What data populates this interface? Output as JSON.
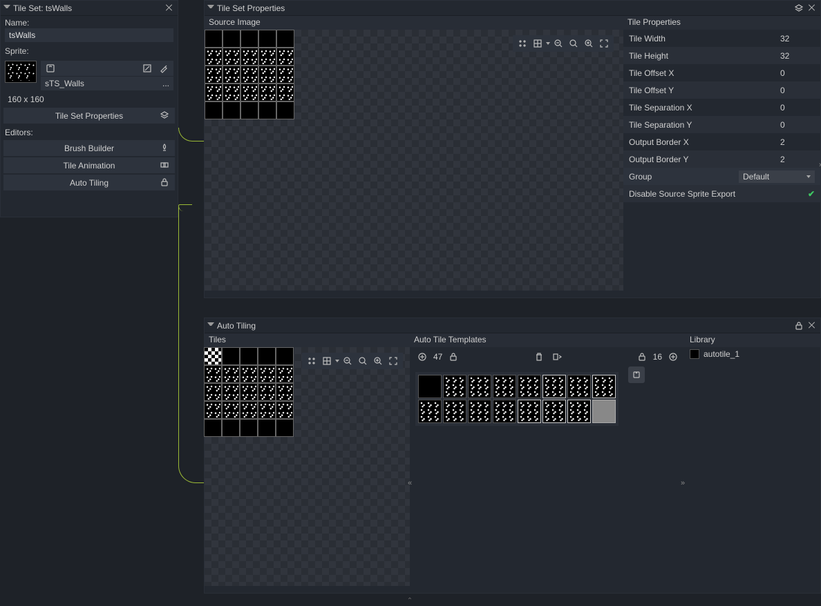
{
  "left_panel": {
    "title": "Tile Set: tsWalls",
    "name_label": "Name:",
    "name_value": "tsWalls",
    "sprite_label": "Sprite:",
    "sprite_name": "sTS_Walls",
    "sprite_more": "...",
    "dimensions": "160 x 160",
    "tsp_btn": "Tile Set Properties",
    "editors_label": "Editors:",
    "brush_btn": "Brush Builder",
    "anim_btn": "Tile Animation",
    "auto_btn": "Auto Tiling"
  },
  "props_panel": {
    "title": "Tile Set Properties",
    "source_label": "Source Image",
    "tile_props_label": "Tile Properties",
    "rows": [
      {
        "label": "Tile Width",
        "value": "32"
      },
      {
        "label": "Tile Height",
        "value": "32"
      },
      {
        "label": "Tile Offset X",
        "value": "0"
      },
      {
        "label": "Tile Offset Y",
        "value": "0"
      },
      {
        "label": "Tile Separation X",
        "value": "0"
      },
      {
        "label": "Tile Separation Y",
        "value": "0"
      },
      {
        "label": "Output Border X",
        "value": "2"
      },
      {
        "label": "Output Border Y",
        "value": "2"
      }
    ],
    "group_label": "Group",
    "group_value": "Default",
    "disable_src": "Disable Source Sprite Export"
  },
  "auto_panel": {
    "title": "Auto Tiling",
    "tiles_label": "Tiles",
    "templates_label": "Auto Tile Templates",
    "library_label": "Library",
    "template_count": "47",
    "tile_count": "16",
    "lib_item": "autotile_1"
  }
}
